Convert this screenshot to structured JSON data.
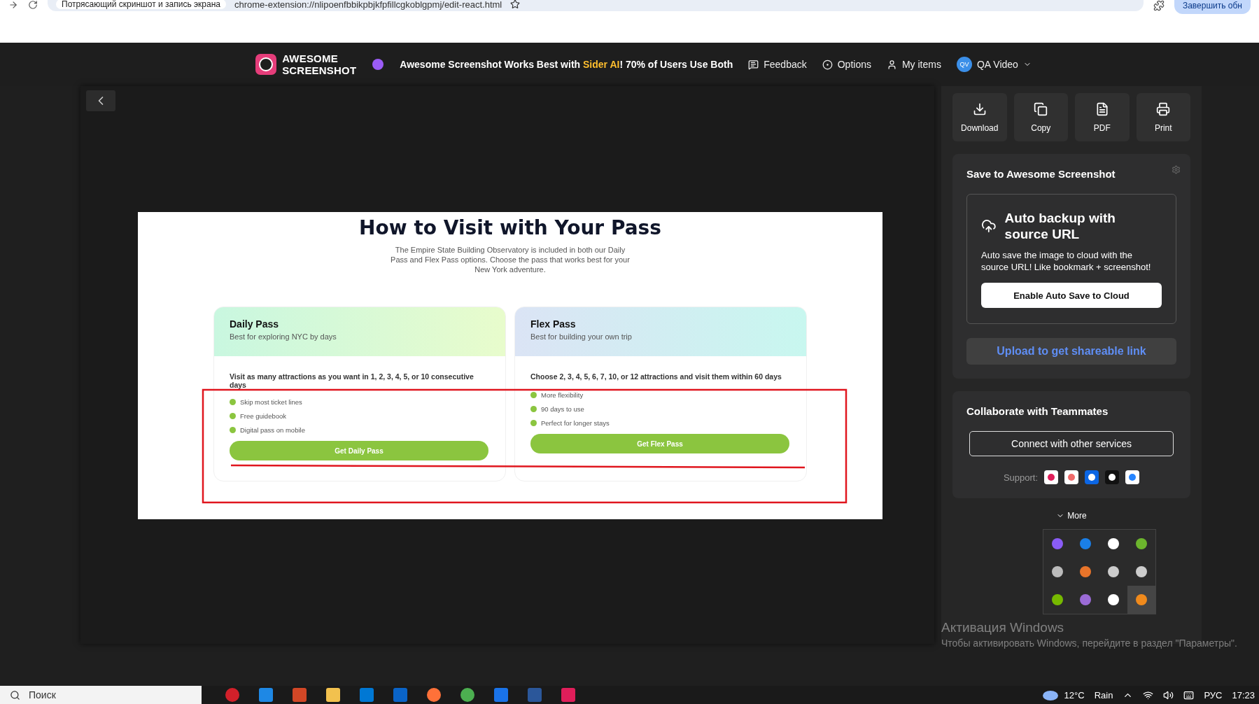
{
  "browser": {
    "tab_title": "Потрясающий скриншот и запись экрана",
    "url": "chrome-extension://nlipoenfbbikpbjkfpfillcgkoblgpmj/edit-react.html",
    "profile_button": "Завершить обн"
  },
  "header": {
    "logo_lines": [
      "AWESOME",
      "SCREENSHOT"
    ],
    "promo_before": "Awesome Screenshot Works Best with ",
    "promo_highlight": "Sider AI",
    "promo_after": "! 70% of Users Use Both",
    "nav": [
      {
        "kind": "feedback",
        "label": "Feedback"
      },
      {
        "kind": "options",
        "label": "Options"
      },
      {
        "kind": "items",
        "label": "My items"
      }
    ],
    "user": {
      "initials": "QV",
      "name": "QA Video"
    }
  },
  "screenshot": {
    "title": "How to Visit with Your Pass",
    "intro": "The Empire State Building Observatory is included in both our Daily Pass and Flex Pass options. Choose the pass that works best for your New York adventure.",
    "cards": [
      {
        "kind": "daily",
        "title": "Daily Pass",
        "subtitle": "Best for exploring NYC by days",
        "description": "Visit as many attractions as you want in 1, 2, 3, 4, 5, or 10 consecutive days",
        "features": [
          "Skip most ticket lines",
          "Free guidebook",
          "Digital pass on mobile"
        ],
        "button": "Get Daily Pass"
      },
      {
        "kind": "flex",
        "title": "Flex Pass",
        "subtitle": "Best for building your own trip",
        "description": "Choose 2, 3, 4, 5, 6, 7, 10, or 12 attractions and visit them within 60 days",
        "features": [
          "More flexibility",
          "90 days to use",
          "Perfect for longer stays"
        ],
        "button": "Get Flex Pass"
      }
    ]
  },
  "panel": {
    "actions": [
      {
        "kind": "download",
        "label": "Download"
      },
      {
        "kind": "copy",
        "label": "Copy"
      },
      {
        "kind": "pdf",
        "label": "PDF"
      },
      {
        "kind": "print",
        "label": "Print"
      }
    ],
    "save": {
      "title": "Save to Awesome Screenshot",
      "backup_title": "Auto backup with source URL",
      "backup_text": "Auto save the image to cloud with the source URL! Like bookmark + screenshot!",
      "backup_button": "Enable Auto Save to Cloud",
      "upload": "Upload to get shareable link"
    },
    "collab": {
      "title": "Collaborate with Teammates",
      "button": "Connect with other services",
      "support_label": "Support:"
    },
    "more": "More"
  },
  "activation": {
    "title": "Активация Windows",
    "text": "Чтобы активировать Windows, перейдите в раздел \"Параметры\"."
  },
  "taskbar": {
    "search_placeholder": "Поиск",
    "temperature": "12°C",
    "condition": "Rain",
    "language": "РУС",
    "time": "17:23"
  }
}
